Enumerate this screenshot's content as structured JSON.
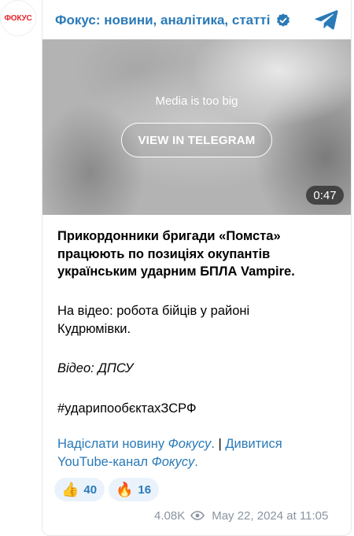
{
  "avatar": {
    "text": "ФОКУС"
  },
  "channel": {
    "title": "Фокус: новини, аналітика, статті"
  },
  "media": {
    "message": "Media is too big",
    "button_label": "VIEW IN TELEGRAM",
    "duration": "0:47"
  },
  "post": {
    "headline": "Прикордонники бригади «Помста» працюють по позиціях окупантів українським ударним БПЛА Vampire.",
    "paragraph": "На відео: робота бійців у районі Кудрюмівки.",
    "credit": "Відео: ДПСУ",
    "hashtag": "#ударипообєктахЗСРФ",
    "links": {
      "send_news_prefix": "Надіслати новину ",
      "send_news_italic": "Фокусу",
      "send_news_suffix": ".",
      "separator": " | ",
      "youtube_prefix": "Дивитися YouTube-канал ",
      "youtube_italic": "Фокусу",
      "youtube_suffix": "."
    }
  },
  "reactions": [
    {
      "emoji": "👍",
      "count": "40"
    },
    {
      "emoji": "🔥",
      "count": "16"
    }
  ],
  "meta": {
    "views": "4.08K",
    "date": "May 22, 2024 at 11:05"
  },
  "colors": {
    "accent": "#2a7ab8",
    "logo_red": "#e5262d",
    "reaction_bg": "#eaf3fb",
    "meta_gray": "#8a94a0"
  }
}
